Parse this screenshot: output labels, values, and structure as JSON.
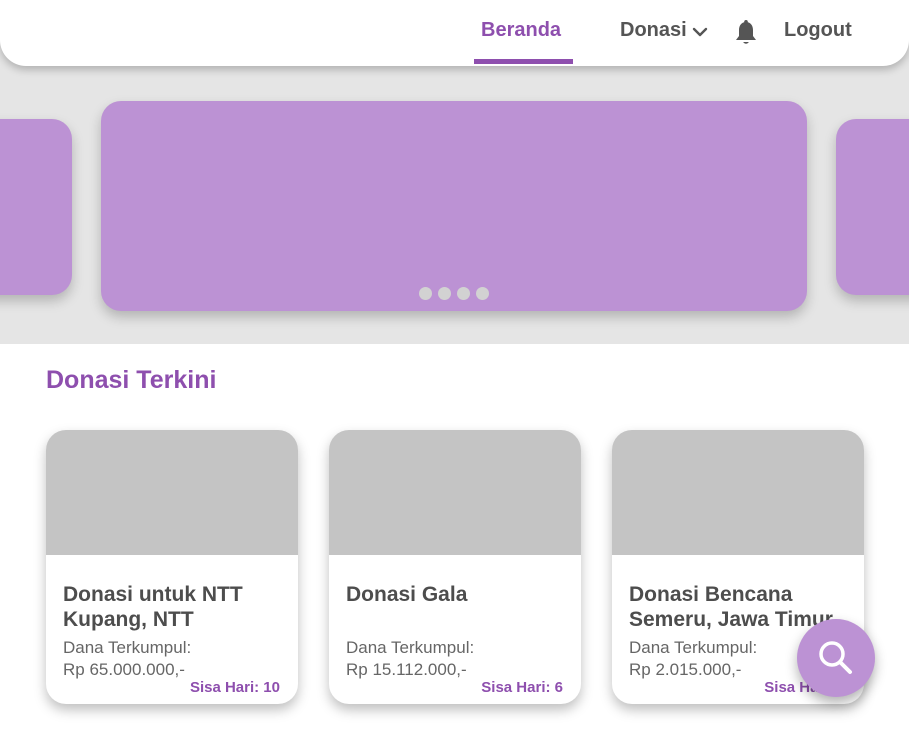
{
  "nav": {
    "home_label": "Beranda",
    "donate_label": "Donasi",
    "logout_label": "Logout"
  },
  "carousel": {
    "dot_count": 4
  },
  "section": {
    "title": "Donasi Terkini"
  },
  "cards": [
    {
      "title": "Donasi untuk NTT\nKupang, NTT",
      "collected_label": "Dana Terkumpul:",
      "amount": "Rp 65.000.000,-",
      "days_left": "Sisa Hari: 10"
    },
    {
      "title": "Donasi Gala",
      "collected_label": "Dana Terkumpul:",
      "amount": "Rp 15.112.000,-",
      "days_left": "Sisa Hari: 6"
    },
    {
      "title": "Donasi Bencana\nSemeru, Jawa Timur",
      "collected_label": "Dana Terkumpul:",
      "amount": "Rp 2.015.000,-",
      "days_left": "Sisa Hari: 3"
    }
  ],
  "colors": {
    "accent": "#8e4fae",
    "slide": "#bc92d4",
    "image_placeholder": "#c4c4c4"
  },
  "icons": {
    "dropdown": "chevron-down-icon",
    "notifications": "bell-icon",
    "search": "search-icon"
  }
}
